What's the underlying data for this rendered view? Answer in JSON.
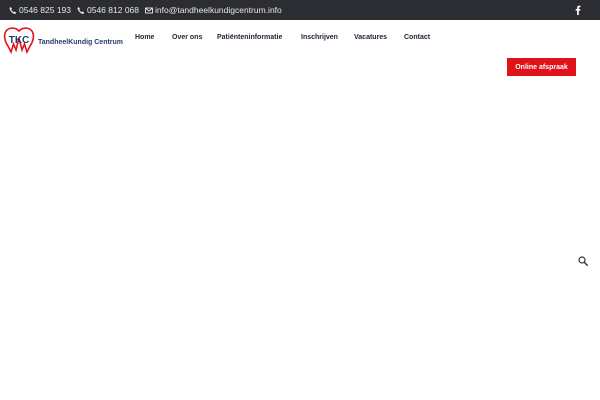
{
  "topbar": {
    "phone1": "0546 825 193",
    "phone2": "0546 812 068",
    "email": "info@tandheelkundigcentrum.info",
    "icons": {
      "phone": "phone-icon",
      "email": "envelope-icon",
      "social": "facebook-icon"
    },
    "background_color": "#2b2d33"
  },
  "logo": {
    "mark": "TKC",
    "name": "TandheelKundig Centrum",
    "colors": {
      "red": "#e0131b",
      "navy": "#2a3a6b"
    }
  },
  "nav": {
    "items": [
      "Home",
      "Over ons",
      "Patiënteninformatie",
      "Inschrijven",
      "Vacatures",
      "Contact"
    ]
  },
  "cta": {
    "label": "Online afspraak",
    "color": "#e0131b"
  },
  "search": {
    "icon": "search-icon"
  }
}
